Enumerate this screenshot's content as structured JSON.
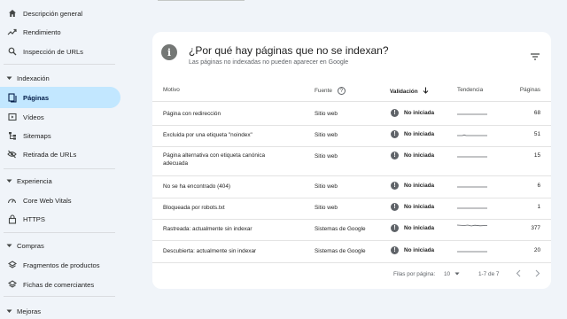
{
  "sidebar": {
    "top_items": [
      {
        "label": "Descripción general",
        "icon": "home-icon"
      },
      {
        "label": "Rendimiento",
        "icon": "trending-up-icon"
      },
      {
        "label": "Inspección de URLs",
        "icon": "search-icon"
      }
    ],
    "sections": [
      {
        "label": "Indexación",
        "items": [
          {
            "label": "Páginas",
            "icon": "pages-icon",
            "active": true
          },
          {
            "label": "Vídeos",
            "icon": "video-icon"
          },
          {
            "label": "Sitemaps",
            "icon": "sitemap-icon"
          },
          {
            "label": "Retirada de URLs",
            "icon": "eye-off-icon"
          }
        ]
      },
      {
        "label": "Experiencia",
        "items": [
          {
            "label": "Core Web Vitals",
            "icon": "gauge-icon"
          },
          {
            "label": "HTTPS",
            "icon": "lock-icon"
          }
        ]
      },
      {
        "label": "Compras",
        "items": [
          {
            "label": "Fragmentos de productos",
            "icon": "layers-icon"
          },
          {
            "label": "Fichas de comerciantes",
            "icon": "layers-icon"
          }
        ]
      },
      {
        "label": "Mejoras",
        "items": []
      }
    ]
  },
  "card": {
    "title": "¿Por qué hay páginas que no se indexan?",
    "subtitle": "Las páginas no indexadas no pueden aparecer en Google",
    "columns": {
      "motivo": "Motivo",
      "fuente": "Fuente",
      "validacion": "Validación",
      "tendencia": "Tendencia",
      "paginas": "Páginas"
    },
    "rows": [
      {
        "motivo": "Página con redirección",
        "fuente": "Sitio web",
        "validacion": "No iniciada",
        "paginas": "68"
      },
      {
        "motivo": "Excluida por una etiqueta \"noindex\"",
        "fuente": "Sitio web",
        "validacion": "No iniciada",
        "paginas": "51"
      },
      {
        "motivo": "Página alternativa con etiqueta canónica adecuada",
        "fuente": "Sitio web",
        "validacion": "No iniciada",
        "paginas": "15"
      },
      {
        "motivo": "No se ha encontrado (404)",
        "fuente": "Sitio web",
        "validacion": "No iniciada",
        "paginas": "6"
      },
      {
        "motivo": "Bloqueada por robots.txt",
        "fuente": "Sitio web",
        "validacion": "No iniciada",
        "paginas": "1"
      },
      {
        "motivo": "Rastreada: actualmente sin indexar",
        "fuente": "Sistemas de Google",
        "validacion": "No iniciada",
        "paginas": "377"
      },
      {
        "motivo": "Descubierta: actualmente sin indexar",
        "fuente": "Sistemas de Google",
        "validacion": "No iniciada",
        "paginas": "20"
      }
    ],
    "footer": {
      "rows_per_page_label": "Filas por página:",
      "rows_per_page_value": "10",
      "range": "1-7 de 7"
    }
  },
  "colors": {
    "active_bg": "#c2e7ff",
    "status_icon": "#5f6368",
    "page_bg": "#f0f4f9"
  }
}
